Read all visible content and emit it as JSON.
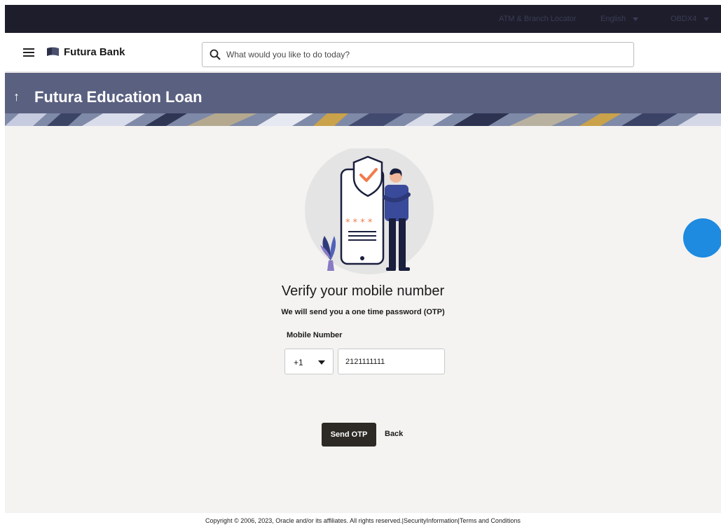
{
  "topbar": {
    "atm_locator": "ATM & Branch Locator",
    "language": "English",
    "user": "OBDX4"
  },
  "header": {
    "brand": "Futura Bank",
    "search_placeholder": "What would you like to do today?"
  },
  "banner": {
    "title": "Futura Education Loan"
  },
  "main": {
    "heading": "Verify your mobile number",
    "subheading": "We will send you a one time password (OTP)",
    "mobile_label": "Mobile Number",
    "country_code": "+1",
    "mobile_value": "2121111111",
    "send_label": "Send OTP",
    "back_label": "Back"
  },
  "footer": {
    "copyright": "Copyright © 2006, 2023, Oracle and/or its affiliates. All rights reserved.",
    "sep1": "|",
    "security": "SecurityInformation",
    "sep2": "|",
    "terms": "Terms and Conditions"
  },
  "colors": {
    "topbar": "#1d1d2b",
    "banner": "#5a6080",
    "primary_button": "#2d2a26",
    "accent_orange": "#f07c4a",
    "fab": "#1e8ae0"
  },
  "icons": [
    "hamburger-icon",
    "bank-logo-icon",
    "search-icon",
    "back-arrow-icon",
    "dropdown-caret-icon",
    "help-chat-icon"
  ]
}
